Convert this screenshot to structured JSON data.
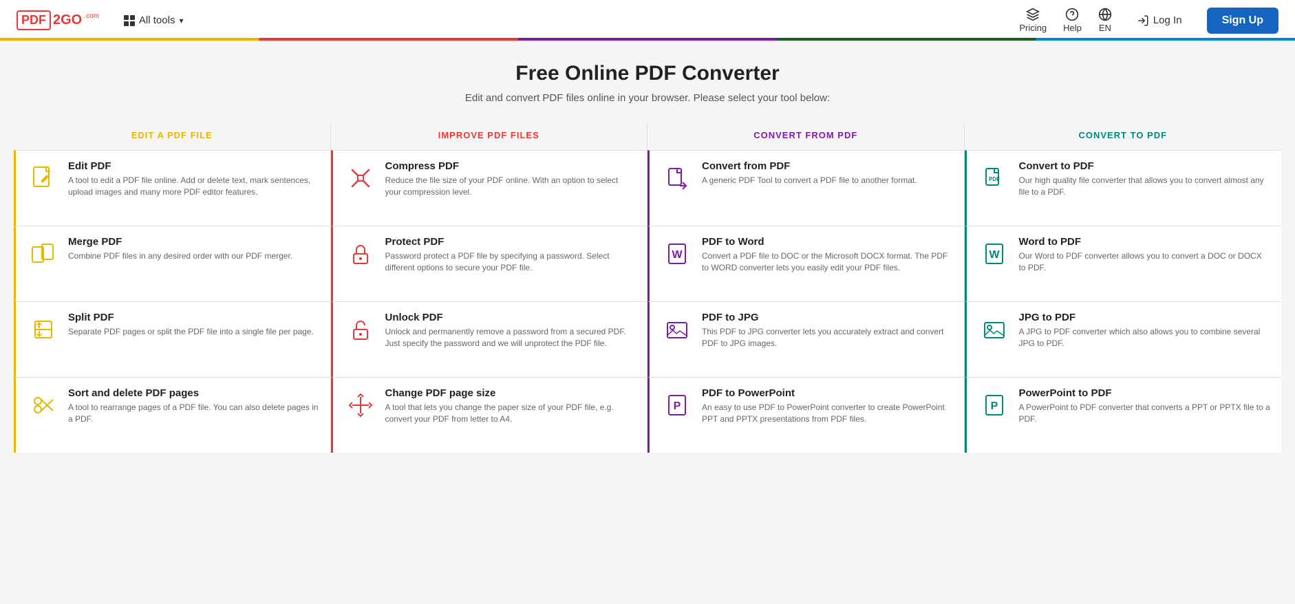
{
  "header": {
    "logo_pdf": "PDF",
    "logo_2go": "2GO",
    "logo_com": ".com",
    "all_tools_label": "All tools",
    "nav_pricing": "Pricing",
    "nav_help": "Help",
    "nav_language": "EN",
    "login_label": "Log In",
    "signup_label": "Sign Up"
  },
  "main": {
    "title": "Free Online PDF Converter",
    "subtitle": "Edit and convert PDF files online in your browser. Please select your tool below:"
  },
  "columns": [
    {
      "id": "edit",
      "header": "EDIT A PDF FILE",
      "color": "yellow",
      "tools": [
        {
          "title": "Edit PDF",
          "desc": "A tool to edit a PDF file online. Add or delete text, mark sentences, upload images and many more PDF editor features."
        },
        {
          "title": "Merge PDF",
          "desc": "Combine PDF files in any desired order with our PDF merger."
        },
        {
          "title": "Split PDF",
          "desc": "Separate PDF pages or split the PDF file into a single file per page."
        },
        {
          "title": "Sort and delete PDF pages",
          "desc": "A tool to rearrange pages of a PDF file. You can also delete pages in a PDF."
        }
      ]
    },
    {
      "id": "improve",
      "header": "IMPROVE PDF FILES",
      "color": "red",
      "tools": [
        {
          "title": "Compress PDF",
          "desc": "Reduce the file size of your PDF online. With an option to select your compression level."
        },
        {
          "title": "Protect PDF",
          "desc": "Password protect a PDF file by specifying a password. Select different options to secure your PDF file."
        },
        {
          "title": "Unlock PDF",
          "desc": "Unlock and permanently remove a password from a secured PDF. Just specify the password and we will unprotect the PDF file."
        },
        {
          "title": "Change PDF page size",
          "desc": "A tool that lets you change the paper size of your PDF file, e.g. convert your PDF from letter to A4."
        }
      ]
    },
    {
      "id": "from_pdf",
      "header": "CONVERT FROM PDF",
      "color": "purple",
      "tools": [
        {
          "title": "Convert from PDF",
          "desc": "A generic PDF Tool to convert a PDF file to another format."
        },
        {
          "title": "PDF to Word",
          "desc": "Convert a PDF file to DOC or the Microsoft DOCX format. The PDF to WORD converter lets you easily edit your PDF files."
        },
        {
          "title": "PDF to JPG",
          "desc": "This PDF to JPG converter lets you accurately extract and convert PDF to JPG images."
        },
        {
          "title": "PDF to PowerPoint",
          "desc": "An easy to use PDF to PowerPoint converter to create PowerPoint PPT and PPTX presentations from PDF files."
        }
      ]
    },
    {
      "id": "to_pdf",
      "header": "CONVERT TO PDF",
      "color": "teal",
      "tools": [
        {
          "title": "Convert to PDF",
          "desc": "Our high quality file converter that allows you to convert almost any file to a PDF."
        },
        {
          "title": "Word to PDF",
          "desc": "Our Word to PDF converter allows you to convert a DOC or DOCX to PDF."
        },
        {
          "title": "JPG to PDF",
          "desc": "A JPG to PDF converter which also allows you to combine several JPG to PDF."
        },
        {
          "title": "PowerPoint to PDF",
          "desc": "A PowerPoint to PDF converter that converts a PPT or PPTX file to a PDF."
        }
      ]
    }
  ]
}
